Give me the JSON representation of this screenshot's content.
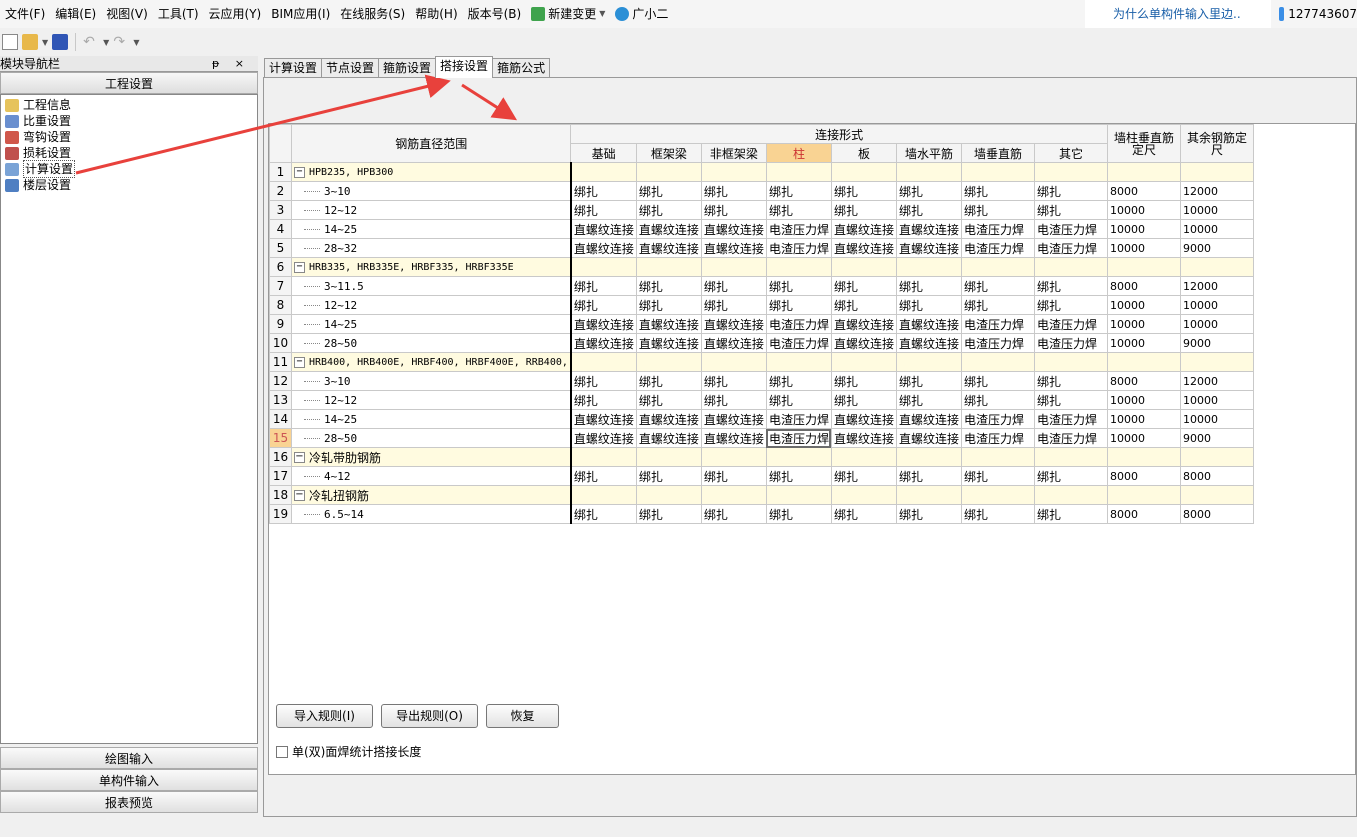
{
  "menu": [
    "文件(F)",
    "编辑(E)",
    "视图(V)",
    "工具(T)",
    "云应用(Y)",
    "BIM应用(I)",
    "在线服务(S)",
    "帮助(H)",
    "版本号(B)",
    "新建变更",
    "广小二"
  ],
  "help_text": "为什么单构件输入里边..",
  "user_text": "127743607",
  "left_panel": {
    "title": "模块导航栏",
    "controls": "ᵽ ×",
    "section": "工程设置",
    "tree": [
      "工程信息",
      "比重设置",
      "弯钩设置",
      "损耗设置",
      "计算设置",
      "楼层设置"
    ],
    "bottom": [
      "绘图输入",
      "单构件输入",
      "报表预览"
    ]
  },
  "tabs": [
    "计算设置",
    "节点设置",
    "箍筋设置",
    "搭接设置",
    "箍筋公式"
  ],
  "grid": {
    "headers": {
      "range": "钢筋直径范围",
      "connect": "连接形式",
      "cols": [
        "基础",
        "框架梁",
        "非框架梁",
        "柱",
        "板",
        "墙水平筋",
        "墙垂直筋",
        "其它"
      ],
      "wall_len": "墙柱垂直筋定尺",
      "other_len": "其余钢筋定尺"
    },
    "rows": [
      {
        "n": "1",
        "group": "HPB235, HPB300"
      },
      {
        "n": "2",
        "range": "3~10",
        "vals": [
          "绑扎",
          "绑扎",
          "绑扎",
          "绑扎",
          "绑扎",
          "绑扎",
          "绑扎",
          "绑扎"
        ],
        "a": "8000",
        "b": "12000"
      },
      {
        "n": "3",
        "range": "12~12",
        "vals": [
          "绑扎",
          "绑扎",
          "绑扎",
          "绑扎",
          "绑扎",
          "绑扎",
          "绑扎",
          "绑扎"
        ],
        "a": "10000",
        "b": "10000"
      },
      {
        "n": "4",
        "range": "14~25",
        "vals": [
          "直螺纹连接",
          "直螺纹连接",
          "直螺纹连接",
          "电渣压力焊",
          "直螺纹连接",
          "直螺纹连接",
          "电渣压力焊",
          "电渣压力焊"
        ],
        "a": "10000",
        "b": "10000"
      },
      {
        "n": "5",
        "range": "28~32",
        "vals": [
          "直螺纹连接",
          "直螺纹连接",
          "直螺纹连接",
          "电渣压力焊",
          "直螺纹连接",
          "直螺纹连接",
          "电渣压力焊",
          "电渣压力焊"
        ],
        "a": "10000",
        "b": "9000"
      },
      {
        "n": "6",
        "group": "HRB335, HRB335E, HRBF335, HRBF335E"
      },
      {
        "n": "7",
        "range": "3~11.5",
        "vals": [
          "绑扎",
          "绑扎",
          "绑扎",
          "绑扎",
          "绑扎",
          "绑扎",
          "绑扎",
          "绑扎"
        ],
        "a": "8000",
        "b": "12000"
      },
      {
        "n": "8",
        "range": "12~12",
        "vals": [
          "绑扎",
          "绑扎",
          "绑扎",
          "绑扎",
          "绑扎",
          "绑扎",
          "绑扎",
          "绑扎"
        ],
        "a": "10000",
        "b": "10000"
      },
      {
        "n": "9",
        "range": "14~25",
        "vals": [
          "直螺纹连接",
          "直螺纹连接",
          "直螺纹连接",
          "电渣压力焊",
          "直螺纹连接",
          "直螺纹连接",
          "电渣压力焊",
          "电渣压力焊"
        ],
        "a": "10000",
        "b": "10000"
      },
      {
        "n": "10",
        "range": "28~50",
        "vals": [
          "直螺纹连接",
          "直螺纹连接",
          "直螺纹连接",
          "电渣压力焊",
          "直螺纹连接",
          "直螺纹连接",
          "电渣压力焊",
          "电渣压力焊"
        ],
        "a": "10000",
        "b": "9000"
      },
      {
        "n": "11",
        "group": "HRB400, HRB400E, HRBF400, HRBF400E, RRB400,"
      },
      {
        "n": "12",
        "range": "3~10",
        "vals": [
          "绑扎",
          "绑扎",
          "绑扎",
          "绑扎",
          "绑扎",
          "绑扎",
          "绑扎",
          "绑扎"
        ],
        "a": "8000",
        "b": "12000"
      },
      {
        "n": "13",
        "range": "12~12",
        "vals": [
          "绑扎",
          "绑扎",
          "绑扎",
          "绑扎",
          "绑扎",
          "绑扎",
          "绑扎",
          "绑扎"
        ],
        "a": "10000",
        "b": "10000"
      },
      {
        "n": "14",
        "range": "14~25",
        "vals": [
          "直螺纹连接",
          "直螺纹连接",
          "直螺纹连接",
          "电渣压力焊",
          "直螺纹连接",
          "直螺纹连接",
          "电渣压力焊",
          "电渣压力焊"
        ],
        "a": "10000",
        "b": "10000"
      },
      {
        "n": "15",
        "range": "28~50",
        "vals": [
          "直螺纹连接",
          "直螺纹连接",
          "直螺纹连接",
          "电渣压力焊",
          "直螺纹连接",
          "直螺纹连接",
          "电渣压力焊",
          "电渣压力焊"
        ],
        "a": "10000",
        "b": "9000",
        "selected": true
      },
      {
        "n": "16",
        "group": "冷轧带肋钢筋",
        "cn": true
      },
      {
        "n": "17",
        "range": "4~12",
        "vals": [
          "绑扎",
          "绑扎",
          "绑扎",
          "绑扎",
          "绑扎",
          "绑扎",
          "绑扎",
          "绑扎"
        ],
        "a": "8000",
        "b": "8000"
      },
      {
        "n": "18",
        "group": "冷轧扭钢筋",
        "cn": true
      },
      {
        "n": "19",
        "range": "6.5~14",
        "vals": [
          "绑扎",
          "绑扎",
          "绑扎",
          "绑扎",
          "绑扎",
          "绑扎",
          "绑扎",
          "绑扎"
        ],
        "a": "8000",
        "b": "8000"
      }
    ]
  },
  "checkbox_label": "单(双)面焊统计搭接长度",
  "buttons": [
    "导入规则(I)",
    "导出规则(O)",
    "恢复"
  ],
  "colors": {
    "highlight": "#f9d393",
    "group_row": "#fffbe0",
    "arrow": "#e8413c"
  }
}
